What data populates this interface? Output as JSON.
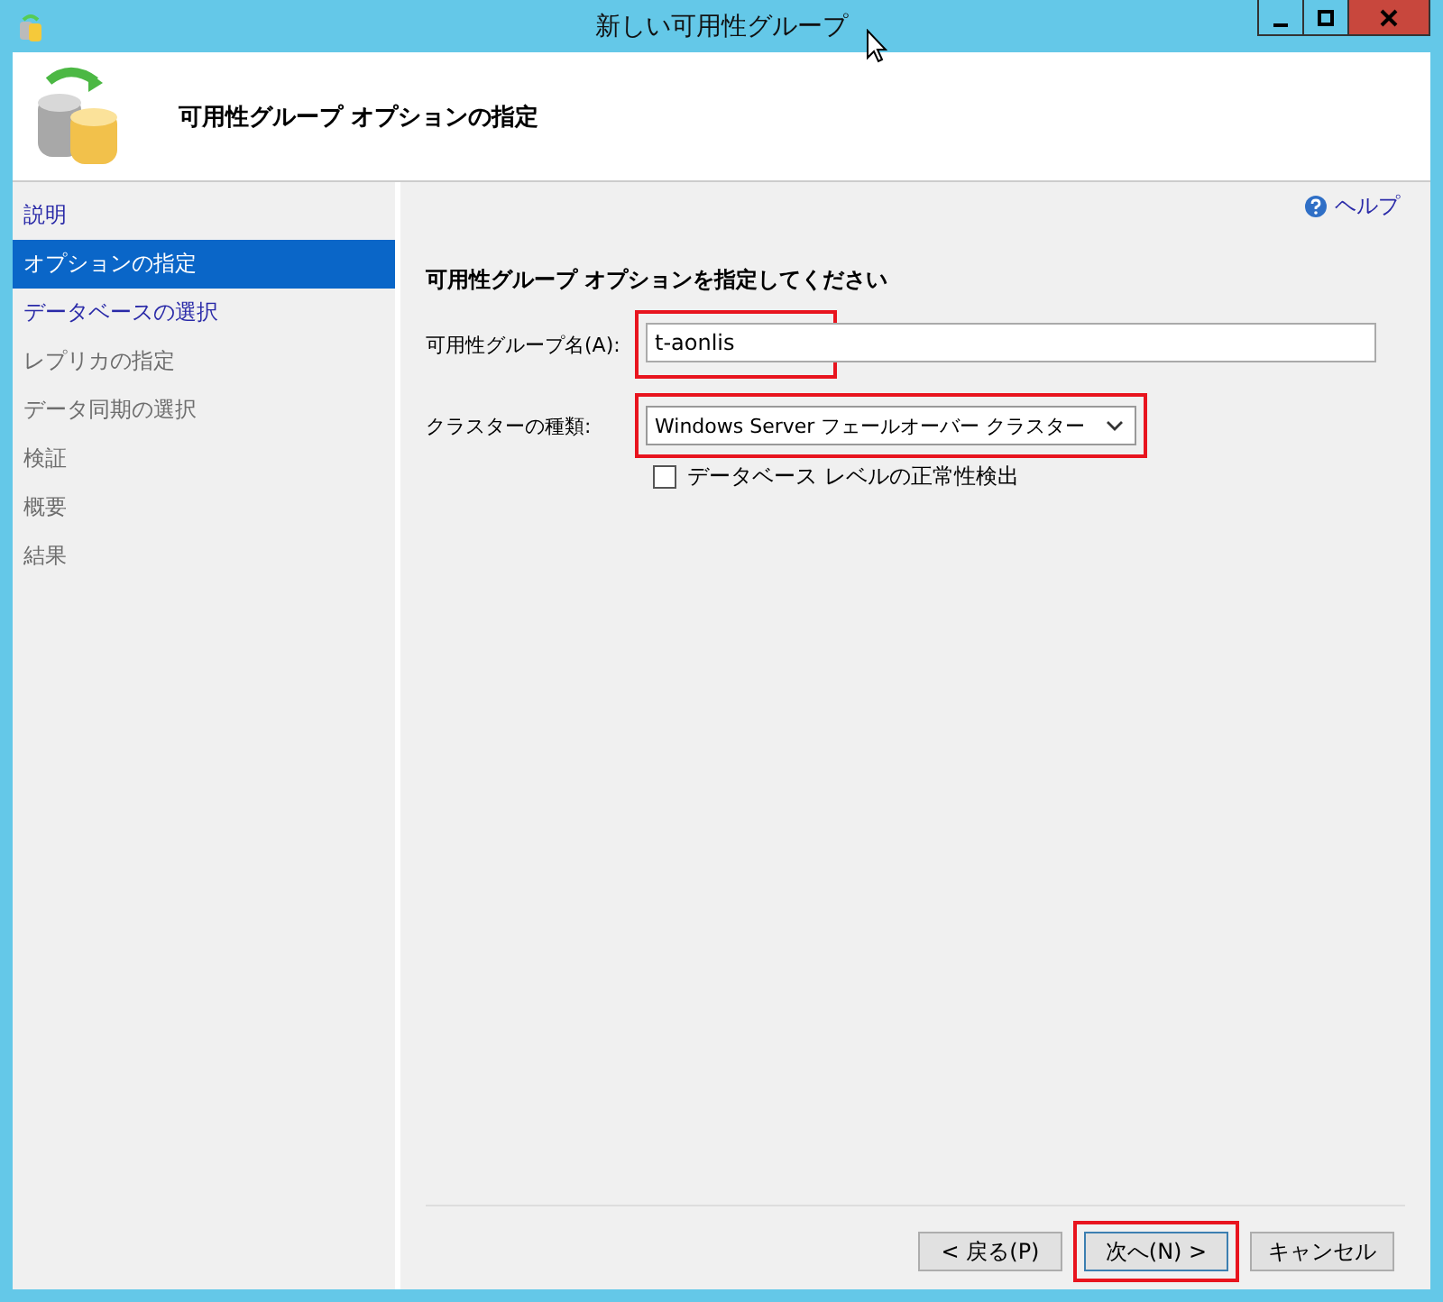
{
  "window": {
    "title": "新しい可用性グループ"
  },
  "header": {
    "title": "可用性グループ オプションの指定"
  },
  "sidebar": {
    "items": [
      {
        "label": "説明",
        "selected": false,
        "disabled": false
      },
      {
        "label": "オプションの指定",
        "selected": true,
        "disabled": false
      },
      {
        "label": "データベースの選択",
        "selected": false,
        "disabled": false
      },
      {
        "label": "レプリカの指定",
        "selected": false,
        "disabled": true
      },
      {
        "label": "データ同期の選択",
        "selected": false,
        "disabled": true
      },
      {
        "label": "検証",
        "selected": false,
        "disabled": true
      },
      {
        "label": "概要",
        "selected": false,
        "disabled": true
      },
      {
        "label": "結果",
        "selected": false,
        "disabled": true
      }
    ]
  },
  "help_link": "ヘルプ",
  "content": {
    "heading": "可用性グループ オプションを指定してください",
    "name_field": {
      "label": "可用性グループ名(A):",
      "value": "t-aonlis",
      "highlighted": true
    },
    "cluster_type": {
      "label": "クラスターの種類:",
      "value": "Windows Server フェールオーバー クラスター",
      "highlighted": true
    },
    "health_check": {
      "label": "データベース レベルの正常性検出",
      "checked": false
    }
  },
  "buttons": [
    {
      "label": "< 戻る(P)",
      "highlighted": false
    },
    {
      "label": "次へ(N) >",
      "highlighted": true
    },
    {
      "label": "キャンセル",
      "highlighted": false
    }
  ]
}
